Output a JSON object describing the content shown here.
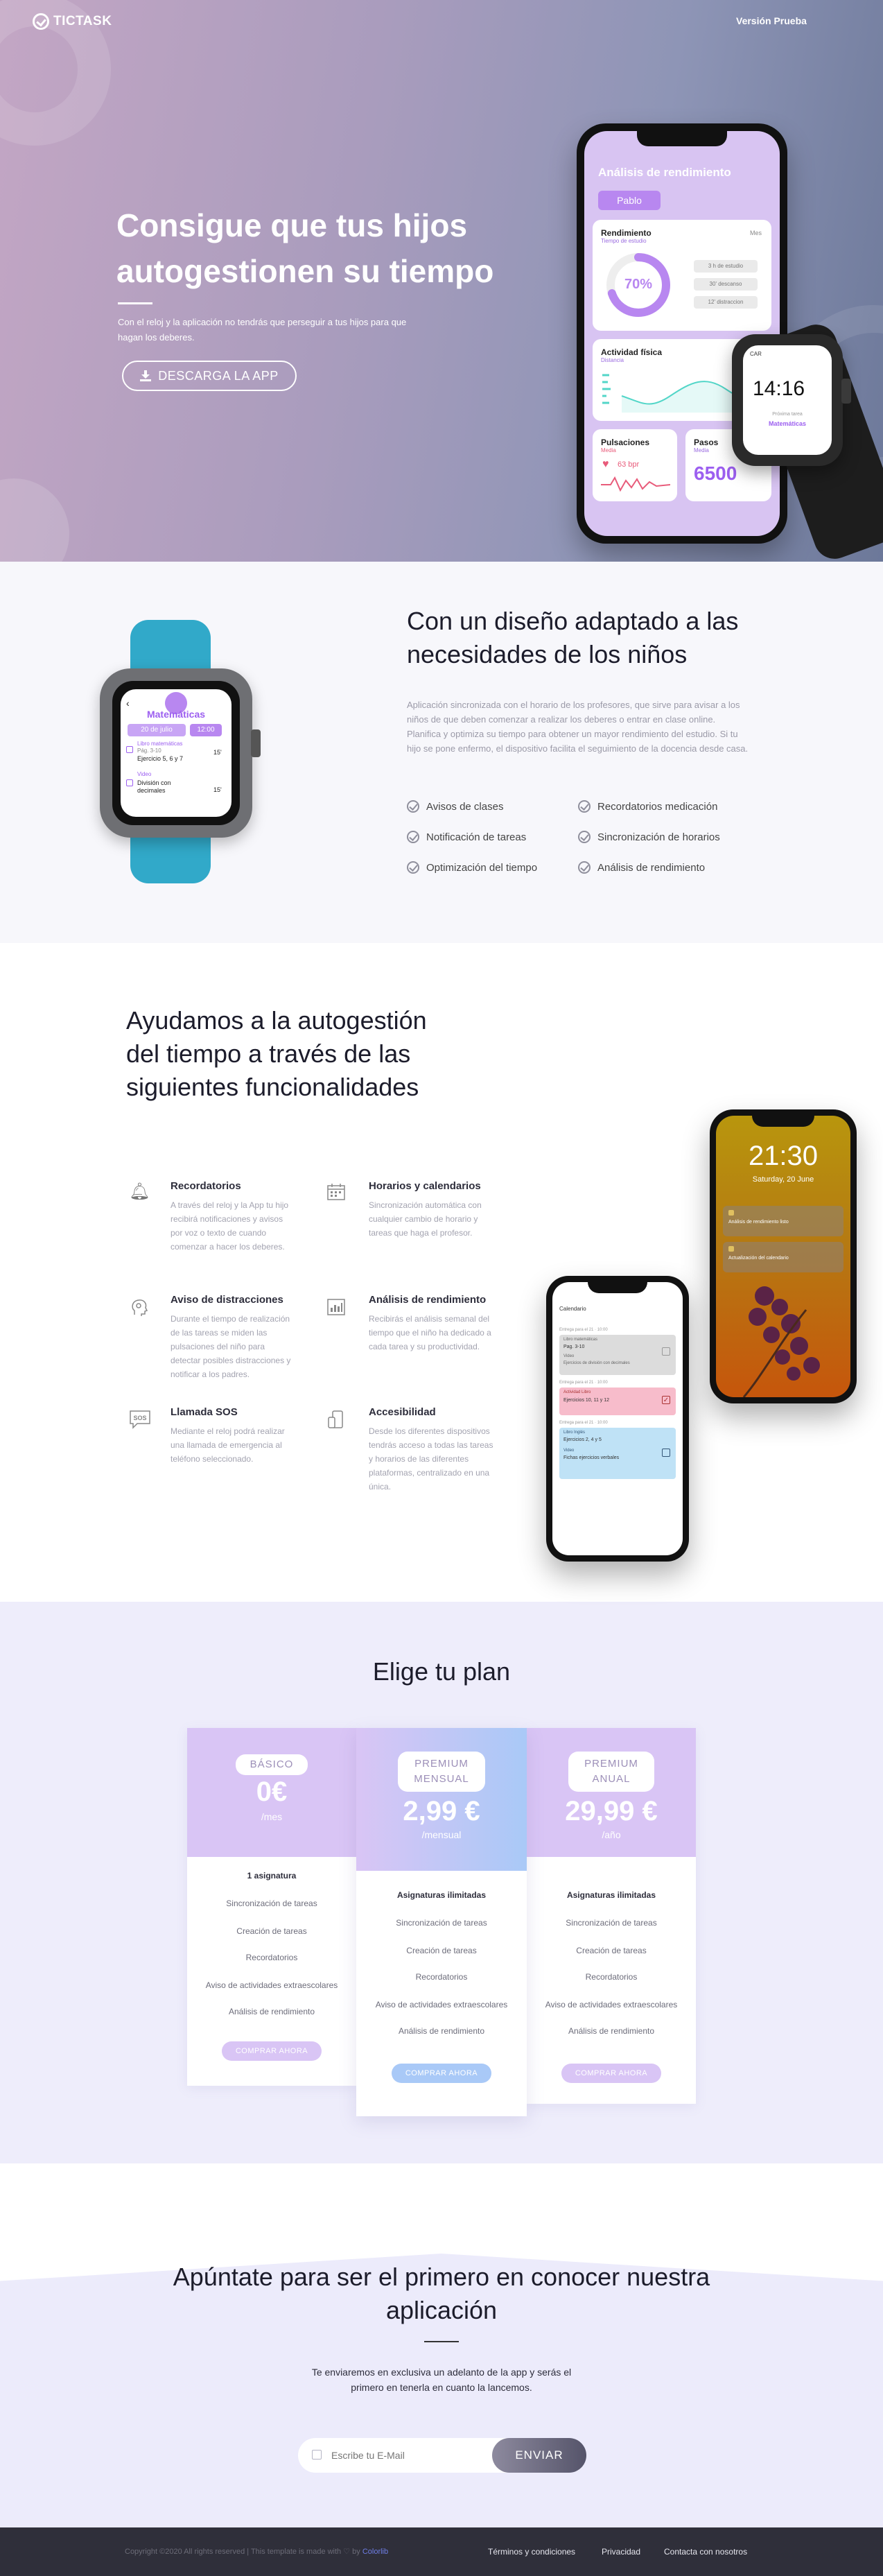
{
  "header": {
    "logo_text": "TICTASK",
    "nav_link": "Versión Prueba"
  },
  "hero": {
    "title": "Consigue que tus hijos autogestionen su tiempo",
    "subtitle": "Con el reloj y la aplicación no tendrás que perseguir a tus hijos para que hagan los deberes.",
    "button": "DESCARGA LA APP"
  },
  "hero_phone": {
    "title": "Análisis de rendimiento",
    "user": "Pablo",
    "performance_title": "Rendimiento",
    "performance_sub": "Tiempo de estudio",
    "period": "Mes",
    "percent": "70%",
    "percent_value": 0.7,
    "stats": [
      "3 h de estudio",
      "30' descanso",
      "12' distraccion"
    ],
    "activity_title": "Actividad física",
    "activity_sub": "Distancia",
    "pulse_title": "Pulsaciones",
    "pulse_sub": "Media",
    "pulse_value": "63 bpr",
    "steps_title": "Pasos",
    "steps_sub": "Media",
    "steps_value": "6500"
  },
  "hero_watch": {
    "time": "14:16",
    "weather": "CAR",
    "subject_line": "Próxima tarea",
    "subject": "Matemáticas"
  },
  "design_section": {
    "title": "Con un diseño adaptado a las necesidades de los niños",
    "paragraph": "Aplicación sincronizada con el horario de los profesores, que sirve para avisar a los niños de que deben comenzar a realizar los deberes o entrar en clase online. Planifica y optimiza su tiempo para obtener un mayor rendimiento del estudio. Si tu hijo se pone enfermo, el dispositivo facilita el seguimiento de la docencia desde casa.",
    "features": [
      "Avisos de clases",
      "Recordatorios medicación",
      "Notificación de tareas",
      "Sincronización de horarios",
      "Optimización del tiempo",
      "Análisis de rendimiento"
    ]
  },
  "watch_app": {
    "subject": "Matemáticas",
    "date": "20 de julio",
    "time": "12:00",
    "tasks": [
      {
        "label": "Libro matemáticas",
        "detail": "Pág. 3-10",
        "title": "Ejercicio 5, 6 y 7",
        "duration": "15'"
      },
      {
        "label": "Video",
        "detail": "",
        "title": "División con decimales",
        "duration": "15'"
      }
    ]
  },
  "functions_section": {
    "title": "Ayudamos a la autogestión del tiempo a través de las siguientes funcionalidades",
    "items": [
      {
        "icon": "bell-icon",
        "title": "Recordatorios",
        "text": "A través del reloj y la App tu hijo recibirá notificaciones y avisos por voz o texto de cuando comenzar a hacer los deberes."
      },
      {
        "icon": "calendar-icon",
        "title": "Horarios y calendarios",
        "text": "Sincronización automática con cualquier cambio de horario y tareas que haga el profesor."
      },
      {
        "icon": "head-icon",
        "title": "Aviso de distracciones",
        "text": "Durante el tiempo de realización de las tareas se miden las pulsaciones del niño para detectar posibles distracciones y notificar a los padres."
      },
      {
        "icon": "chart-icon",
        "title": "Análisis de rendimiento",
        "text": "Recibirás el análisis semanal del tiempo que el niño ha dedicado a cada tarea y su productividad."
      },
      {
        "icon": "sos-icon",
        "title": "Llamada SOS",
        "text": "Mediante el reloj podrá realizar una llamada de emergencia al teléfono seleccionado."
      },
      {
        "icon": "devices-icon",
        "title": "Accesibilidad",
        "text": "Desde los diferentes dispositivos tendrás acceso a todas las tareas y horarios de las diferentes plataformas, centralizado en una única."
      }
    ]
  },
  "lock_phone": {
    "time": "21:30",
    "date": "Saturday, 20 June",
    "notifications": [
      "Análisis de rendimiento listo",
      "Actualización del calendario"
    ]
  },
  "tasks_phone": {
    "header": "Calendario",
    "groups": [
      {
        "meta": "Entrega para el 21 · 10:00",
        "label": "Libro matemáticas",
        "title": "Pag. 3-10",
        "extra": "Video",
        "sub": "Ejercicios de división con decimales"
      },
      {
        "meta": "Entrega para el 21 · 10:00",
        "label": "Actividad Libro",
        "title": "Ejercicios 10, 11 y 12",
        "extra": "",
        "sub": ""
      },
      {
        "meta": "Entrega para el 21 · 10:00",
        "label": "Libro Inglés",
        "title": "Ejercicios 2, 4 y 5",
        "extra": "Video",
        "sub": "Fichas ejercicios verbales"
      }
    ]
  },
  "pricing": {
    "title": "Elige tu plan",
    "plans": [
      {
        "badge": "BÁSICO",
        "price": "0€",
        "period": "/mes",
        "items": [
          "1 asignatura",
          "Sincronización de tareas",
          "Creación de tareas",
          "Recordatorios",
          "Aviso de actividades extraescolares",
          "Análisis de rendimiento"
        ],
        "button": "COMPRAR AHORA"
      },
      {
        "badge": "PREMIUM MENSUAL",
        "price": "2,99 €",
        "period": "/mensual",
        "items": [
          "Asignaturas ilimitadas",
          "Sincronización de tareas",
          "Creación de tareas",
          "Recordatorios",
          "Aviso de actividades extraescolares",
          "Análisis de rendimiento"
        ],
        "button": "COMPRAR AHORA"
      },
      {
        "badge": "PREMIUM ANUAL",
        "price": "29,99 €",
        "period": "/año",
        "items": [
          "Asignaturas ilimitadas",
          "Sincronización de tareas",
          "Creación de tareas",
          "Recordatorios",
          "Aviso de actividades extraescolares",
          "Análisis de rendimiento"
        ],
        "button": "COMPRAR AHORA"
      }
    ]
  },
  "signup": {
    "title": "Apúntate para ser el primero en conocer nuestra aplicación",
    "text": "Te enviaremos en exclusiva un adelanto de la app y serás el primero en tenerla en cuanto la lancemos.",
    "placeholder": "Escribe tu E-Mail",
    "button": "ENVIAR"
  },
  "footer": {
    "copyright": "Copyright ©2020 All rights reserved | This template is made with ♡ by ",
    "credit": "Colorlib",
    "links": [
      "Términos y condiciones",
      "Privacidad",
      "Contacta con nosotros"
    ]
  },
  "colors": {
    "accent": "#b887f0",
    "purple_light": "#d8c4f2",
    "blue_light": "#a9c9f7",
    "footer": "#2f2f3a"
  }
}
